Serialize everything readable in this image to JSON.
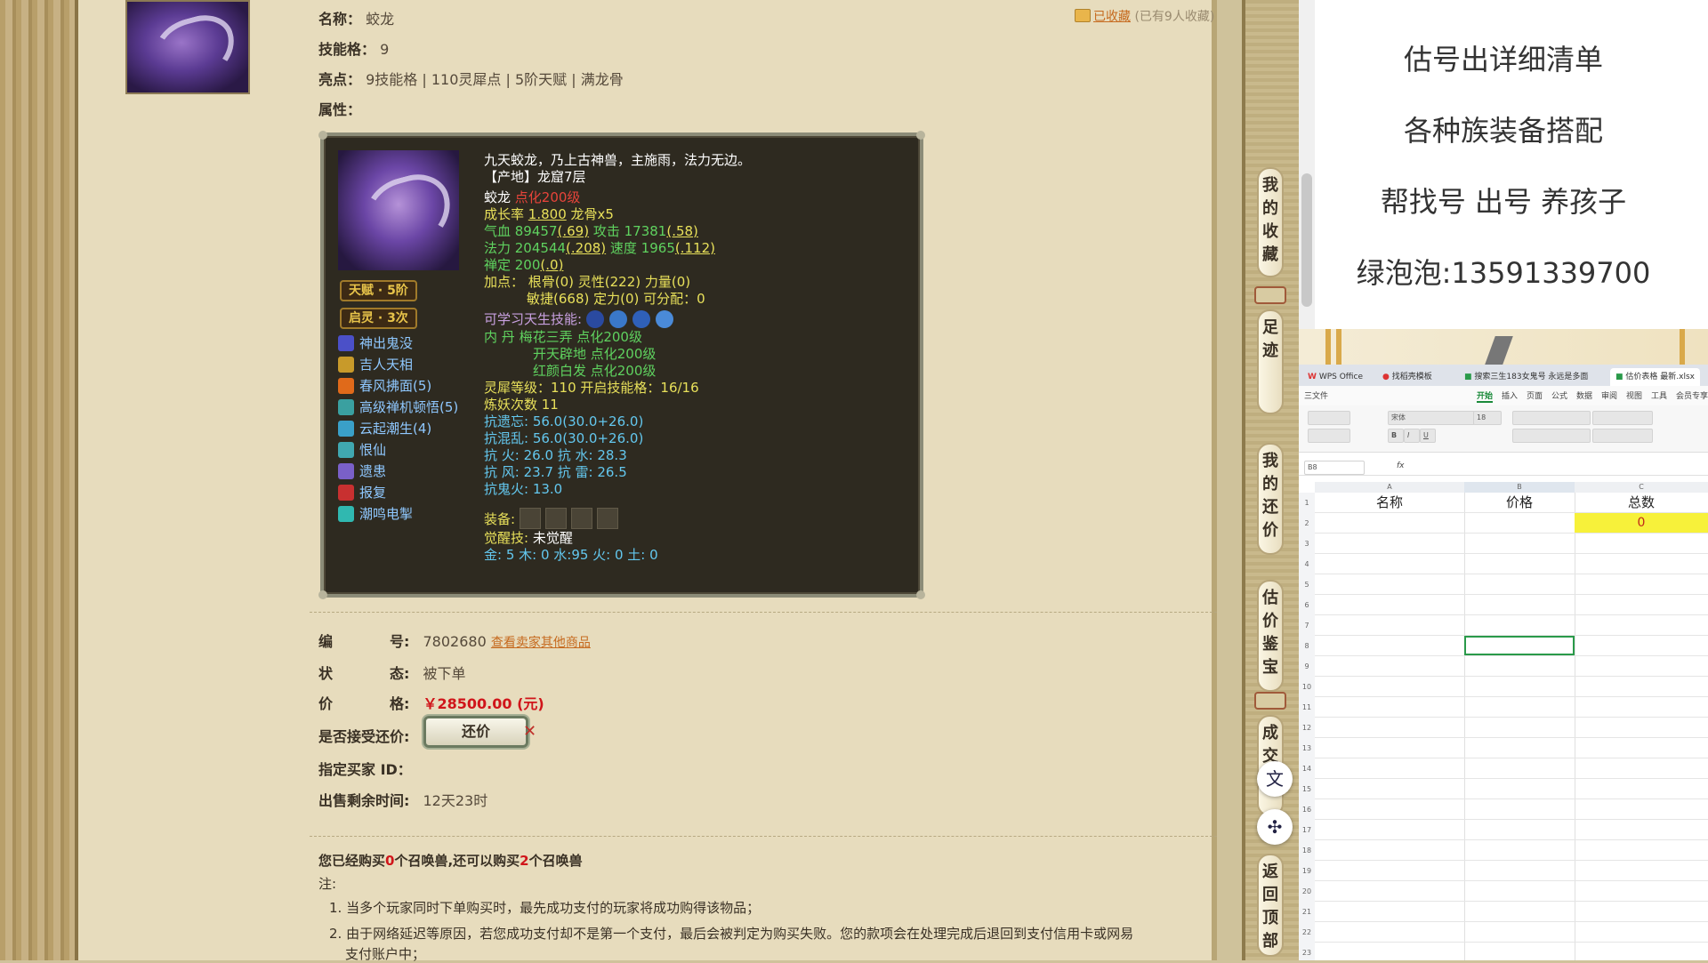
{
  "listing": {
    "name_label": "名称：",
    "name_value": "蛟龙",
    "slots_label": "技能格：",
    "slots_value": "9",
    "highlights_label": "亮点：",
    "highlights_value": "9技能格 | 110灵犀点 | 5阶天赋 | 满龙骨",
    "attrs_label": "属性：",
    "favorite_link": "已收藏",
    "favorite_count": "(已有9人收藏)"
  },
  "card": {
    "badge_talent": "天赋 · 5阶",
    "badge_enlight": "启灵 · 3次",
    "skills": [
      "神出鬼没",
      "吉人天相",
      "春风拂面(5)",
      "高级禅机顿悟(5)",
      "云起潮生(4)",
      "恨仙",
      "遗患",
      "报复",
      "潮鸣电掣"
    ],
    "desc1": "九天蛟龙，乃上古神兽，主施雨，法力无边。",
    "desc2": "【产地】龙窟7层",
    "pet_name": "蛟龙",
    "pet_level": "点化200级",
    "growth_label": "成长率",
    "growth_value": "1.800",
    "dragon_bone": "龙骨x5",
    "hp_line_a": "气血 89457",
    "hp_line_b": "(.69)",
    "atk_a": "攻击 17381",
    "atk_b": "(.58)",
    "mp_a": "法力 204544",
    "mp_b": "(.208)",
    "spd_a": "速度 1965",
    "spd_b": "(.112)",
    "zen_a": "禅定 200",
    "zen_b": "(.0)",
    "add_line1": "加点：  根骨(0) 灵性(222) 力量(0)",
    "add_line2": "敏捷(668) 定力(0) 可分配：0",
    "innate_label": "可学习天生技能:",
    "inner_label": "内    丹",
    "inner1": "梅花三弄 点化200级",
    "inner2": "开天辟地 点化200级",
    "inner3": "红颜白发 点化200级",
    "spirit": "灵犀等级：110 开启技能格：16/16",
    "refine": "炼妖次数 11",
    "resist1": "抗遗忘: 56.0(30.0+26.0)",
    "resist2": "抗混乱: 56.0(30.0+26.0)",
    "resist3": "抗    火: 26.0 抗    水: 28.3",
    "resist4": "抗    风: 23.7 抗    雷: 26.5",
    "resist5": "抗鬼火: 13.0",
    "equip_label": "装备:",
    "awaken_label": "觉醒技:",
    "awaken_value": "未觉醒",
    "elements": "金: 5 木: 0 水:95 火: 0 土: 0"
  },
  "details": {
    "id_label_a": "编",
    "id_label_b": "号:",
    "id_value": "7802680",
    "id_link": "查看卖家其他商品",
    "status_label_a": "状",
    "status_label_b": "态:",
    "status_value": "被下单",
    "price_label_a": "价",
    "price_label_b": "格:",
    "price_value": "￥28500.00 (元)",
    "haggle_label": "是否接受还价:",
    "haggle_button": "还价",
    "buyer_label": "指定买家 ID：",
    "remain_label": "出售剩余时间:",
    "remain_value": "12天23时"
  },
  "notice": {
    "line_a": "您已经购买",
    "count_a": "0",
    "line_b": "个召唤兽,还可以购买",
    "count_b": "2",
    "line_c": "个召唤兽",
    "note_label": "注:",
    "note1": "1. 当多个玩家同时下单购买时，最先成功支付的玩家将成功购得该物品；",
    "note2": "2. 由于网络延迟等原因，若您成功支付却不是第一个支付，最后会被判定为购买失败。您的款项会在处理完成后退回到支付信用卡或网易",
    "note3": "支付账户中；"
  },
  "sidenav": {
    "fav": "我的收藏",
    "trail": "足迹",
    "offers": "我的还价",
    "appraise": "估价鉴宝",
    "deal": "成交询",
    "top": "返回顶部"
  },
  "ad": {
    "line1": "估号出详细清单",
    "line2": "各种族装备搭配",
    "line3": "帮找号 出号 养孩子",
    "line4": "绿泡泡:13591339700"
  },
  "wps": {
    "tab1": "WPS Office",
    "tab2": "找稻壳模板",
    "tab3": "搜索三生183女鬼号 永远是多面",
    "tab4": "估价表格 最新.xlsx",
    "menu": [
      "三文件",
      "开始",
      "插入",
      "页面",
      "公式",
      "数据",
      "审阅",
      "视图",
      "工具",
      "会员专享"
    ],
    "font_name": "宋体",
    "font_size": "18",
    "cell_ref": "B8",
    "fx": "fx",
    "col_a": "A",
    "col_b": "B",
    "col_c": "C",
    "hdr_name": "名称",
    "hdr_price": "价格",
    "hdr_total": "总数",
    "total_value": "0"
  }
}
